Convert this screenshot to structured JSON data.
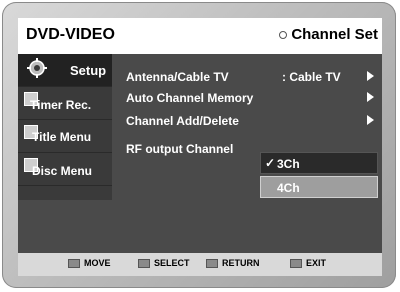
{
  "header": {
    "title": "DVD-VIDEO",
    "section": "Channel Set"
  },
  "sidebar": {
    "items": [
      {
        "label": "Setup",
        "icon": "gear-icon",
        "active": true
      },
      {
        "label": "Timer Rec.",
        "icon": "timer-icon",
        "active": false
      },
      {
        "label": "Title Menu",
        "icon": "title-icon",
        "active": false
      },
      {
        "label": "Disc Menu",
        "icon": "disc-icon",
        "active": false
      }
    ]
  },
  "menu": {
    "items": [
      {
        "label": "Antenna/Cable TV",
        "value": ": Cable TV"
      },
      {
        "label": "Auto Channel Memory",
        "value": ""
      },
      {
        "label": "Channel Add/Delete",
        "value": ""
      },
      {
        "label": "RF output Channel",
        "value": ""
      }
    ],
    "rf_options": [
      {
        "label": "3Ch",
        "selected": true,
        "check": "✓"
      },
      {
        "label": "4Ch",
        "selected": false
      }
    ]
  },
  "footer": {
    "move": "MOVE",
    "select": "SELECT",
    "return": "RETURN",
    "exit": "EXIT"
  }
}
